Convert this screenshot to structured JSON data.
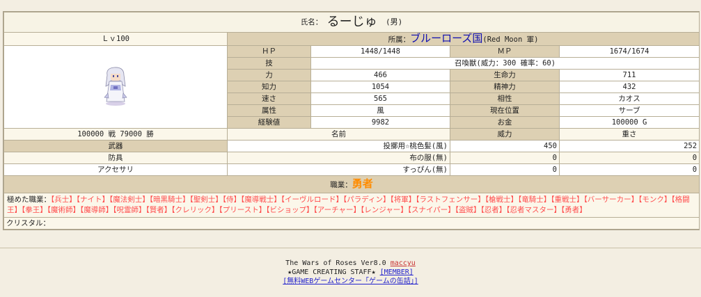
{
  "character": {
    "name_label": "氏名：",
    "name": "るーじゅ",
    "gender": "(男)",
    "level": "Ｌｖ100",
    "affiliation_label": "所属：",
    "nation": "ブルーローズ国",
    "nation_sub": "(Red Moon 軍)",
    "record": "100000 戦 79000 勝"
  },
  "stats": {
    "hp_label": "ＨＰ",
    "hp": "1448/1448",
    "mp_label": "ＭＰ",
    "mp": "1674/1674",
    "skill_label": "技",
    "skill": "召喚獣(威力：300 確率：60)",
    "str_label": "力",
    "str": "466",
    "vit_label": "生命力",
    "vit": "711",
    "int_label": "知力",
    "int": "1054",
    "mnd_label": "精神力",
    "mnd": "432",
    "spd_label": "速さ",
    "spd": "565",
    "align_label": "相性",
    "align": "カオス",
    "elem_label": "属性",
    "elem": "風",
    "loc_label": "現在位置",
    "loc": "サーブ",
    "exp_label": "経験値",
    "exp": "9982",
    "gold_label": "お金",
    "gold": "100000 G"
  },
  "equipment": {
    "col_name": "名前",
    "col_power": "威力",
    "col_weight": "重さ",
    "rows": [
      {
        "slot": "武器",
        "name": "投擲用☆桃色髪(風)",
        "power": "450",
        "weight": "252"
      },
      {
        "slot": "防具",
        "name": "布の服(無)",
        "power": "0",
        "weight": "0"
      },
      {
        "slot": "アクセサリ",
        "name": "すっぴん(無)",
        "power": "0",
        "weight": "0"
      }
    ]
  },
  "job": {
    "label": "職業：",
    "current": "勇者",
    "mastered_label": "極めた職業：",
    "mastered": [
      "【兵士】",
      "【ナイト】",
      "【魔法剣士】",
      "【暗黒騎士】",
      "【聖剣士】",
      "【侍】",
      "【魔導戦士】",
      "【イーヴルロード】",
      "【パラディン】",
      "【将軍】",
      "【ラストフェンサー】",
      "【槍戦士】",
      "【竜騎士】",
      "【重戦士】",
      "【バーサーカー】",
      "【モンク】",
      "【格闘王】",
      "【拳王】",
      "【魔術師】",
      "【魔導師】",
      "【呪霊師】",
      "【賢者】",
      "【クレリック】",
      "【プリースト】",
      "【ビショップ】",
      "【アーチャー】",
      "【レンジャー】",
      "【スナイパー】",
      "【盗賊】",
      "【忍者】",
      "【忍者マスター】",
      "【勇者】"
    ]
  },
  "crystal_label": "クリスタル：",
  "footer": {
    "version": "The Wars of Roses Ver8.0",
    "author": "maccyu",
    "staff": "★GAME CREATING STAFF★",
    "member": "[MEMBER]",
    "center": "[無料WEBゲームセンター「ゲームの缶詰」]"
  },
  "colors": {
    "background": "#f3eee2",
    "header_cell": "#ddd0b3",
    "nation": "#0b0bb0",
    "job": "#ff8c00",
    "mastered_job": "#ff4d4d"
  },
  "icons": {
    "character_sprite": "white-haired-summoner-sprite"
  }
}
